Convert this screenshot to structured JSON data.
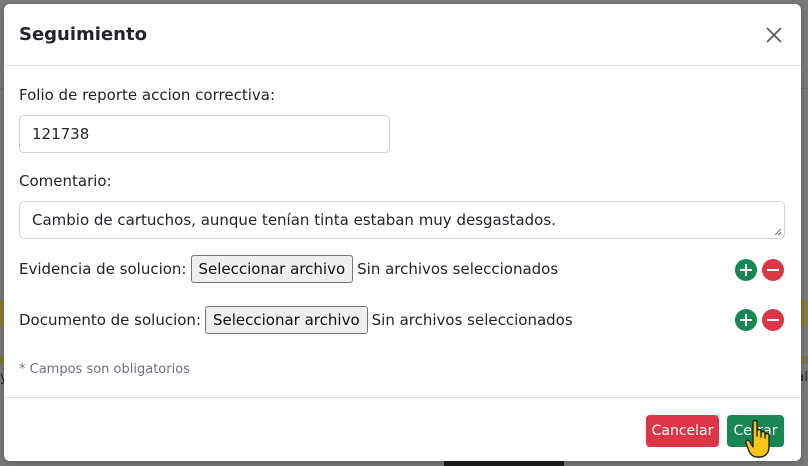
{
  "modal": {
    "title": "Seguimiento",
    "close_icon": "close-icon"
  },
  "form": {
    "folio_label": "Folio de reporte accion correctiva:",
    "folio_value": "121738",
    "comment_label": "Comentario:",
    "comment_value": "Cambio de cartuchos, aunque tenían tinta estaban muy desgastados.",
    "evidence_label": "Evidencia de solucion:",
    "evidence_button": "Seleccionar archivo",
    "evidence_status": "Sin archivos seleccionados",
    "document_label": "Documento de solucion:",
    "document_button": "Seleccionar archivo",
    "document_status": "Sin archivos seleccionados",
    "required_note": "* Campos son obligatorios"
  },
  "footer": {
    "cancel_label": "Cancelar",
    "close_label": "Cerrar"
  },
  "colors": {
    "success": "#198754",
    "danger": "#dc3545"
  },
  "backdrop": {
    "left_edge_text": "y",
    "right_edge_text": "al"
  }
}
